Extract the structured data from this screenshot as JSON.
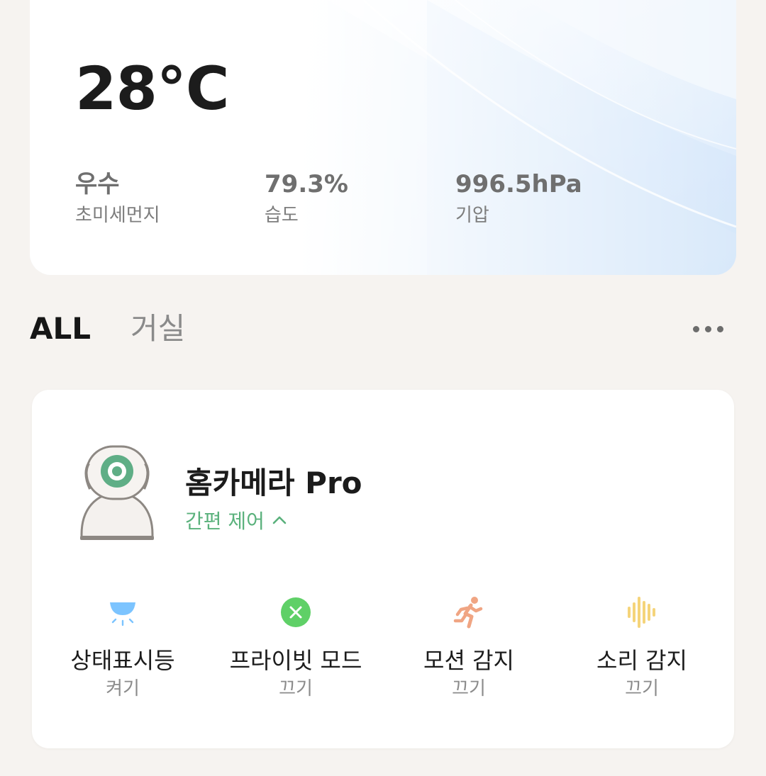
{
  "weather": {
    "temperature": "28°C",
    "stats": [
      {
        "value": "우수",
        "label": "초미세먼지"
      },
      {
        "value": "79.3%",
        "label": "습도"
      },
      {
        "value": "996.5hPa",
        "label": "기압"
      }
    ]
  },
  "tabs": {
    "active": "ALL",
    "items": [
      "ALL",
      "거실"
    ]
  },
  "more_icon": "more-horizontal-icon",
  "device": {
    "name": "홈카메라 Pro",
    "quick_control_label": "간편 제어",
    "quick_control_icon": "chevron-up-icon",
    "controls": [
      {
        "name": "상태표시등",
        "state": "켜기",
        "icon": "indicator-light-icon",
        "color": "#7cc4ff"
      },
      {
        "name": "프라이빗 모드",
        "state": "끄기",
        "icon": "private-mode-icon",
        "color": "#5fd067"
      },
      {
        "name": "모션 감지",
        "state": "끄기",
        "icon": "motion-detection-icon",
        "color": "#f0a583"
      },
      {
        "name": "소리 감지",
        "state": "끄기",
        "icon": "sound-detection-icon",
        "color": "#f5d47a"
      }
    ]
  },
  "colors": {
    "accent_green": "#5ab17c",
    "background": "#f6f3f0"
  }
}
